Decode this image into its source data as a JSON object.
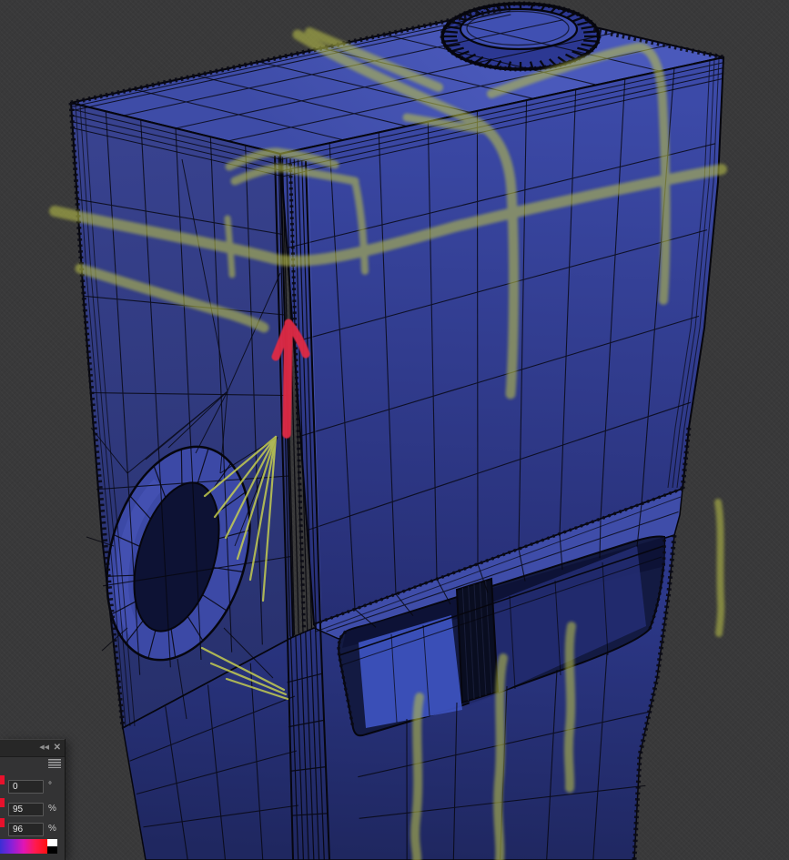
{
  "viewport": {
    "background_color": "#39393a",
    "model": {
      "surface_top_a": "#4a59bb",
      "surface_top_b": "#3e4ca7",
      "surface_right_top": "#3c4aa8",
      "surface_right_bottom": "#262e74",
      "surface_left_top": "#38428f",
      "surface_left_bottom": "#27306c",
      "ledge": "#3f4da9",
      "surface_lower_top": "#2e3a8e",
      "surface_lower_bottom": "#1f2760",
      "interior": "#131a42",
      "interior_shadow": "#0d1234",
      "interior_highlight": "#3f55c4",
      "interior_mid": "#252e74",
      "post": "#090d20",
      "handle_ring": "#3c49a6",
      "handle_hole": "#0d1234",
      "handle_rim_light": "#4e5cc2",
      "cap_rim": "#2c3892",
      "cap_top": "#4050b2",
      "wireframe": "#06060e",
      "edge_highlight": "#5563c0",
      "paint": "#b9c04a",
      "paint_bright": "#ced64f",
      "arrow": "#e02944"
    }
  },
  "color_panel": {
    "header": {
      "collapse_icon": "◀◀",
      "close_icon": "✕"
    },
    "fields": [
      {
        "name": "hue",
        "value": "0",
        "unit": "°"
      },
      {
        "name": "saturation",
        "value": "95",
        "unit": "%"
      },
      {
        "name": "brightness",
        "value": "96",
        "unit": "%"
      }
    ],
    "slider_tip_color": "#e8112c",
    "spectrum_colors": [
      "#3b2fd4",
      "#8a20d8",
      "#e015b5",
      "#ff1a4d",
      "#ff1111"
    ],
    "swatch_white": "#ffffff",
    "swatch_black": "#000000"
  }
}
